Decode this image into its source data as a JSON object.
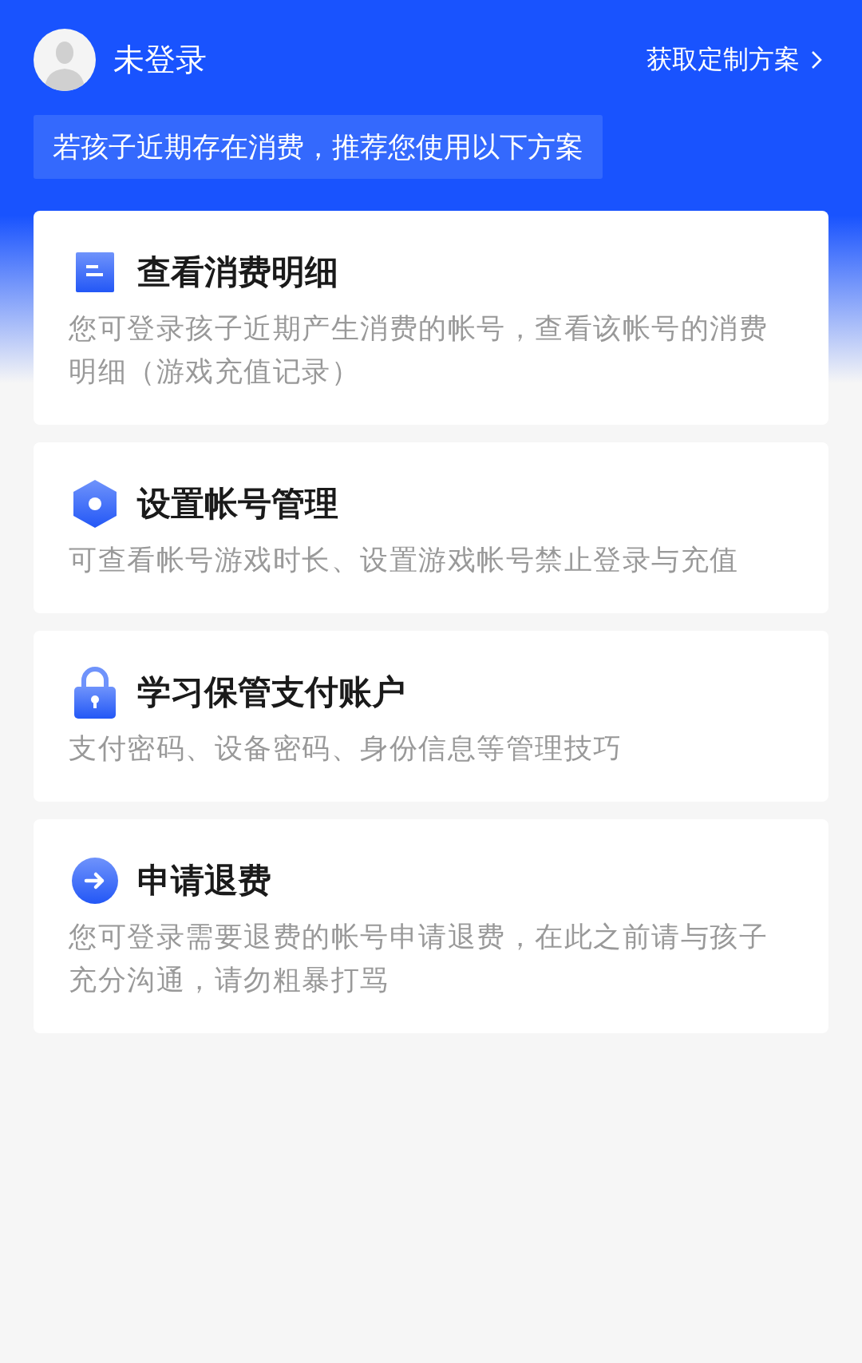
{
  "header": {
    "user_name": "未登录",
    "plan_link": "获取定制方案",
    "banner": "若孩子近期存在消费，推荐您使用以下方案"
  },
  "cards": [
    {
      "kind": "document",
      "title": "查看消费明细",
      "description": "您可登录孩子近期产生消费的帐号，查看该帐号的消费明细（游戏充值记录）"
    },
    {
      "kind": "hexagon",
      "title": "设置帐号管理",
      "description": "可查看帐号游戏时长、设置游戏帐号禁止登录与充值"
    },
    {
      "kind": "lock",
      "title": "学习保管支付账户",
      "description": "支付密码、设备密码、身份信息等管理技巧"
    },
    {
      "kind": "arrow",
      "title": "申请退费",
      "description": "您可登录需要退费的帐号申请退费，在此之前请与孩子充分沟通，请勿粗暴打骂"
    }
  ]
}
